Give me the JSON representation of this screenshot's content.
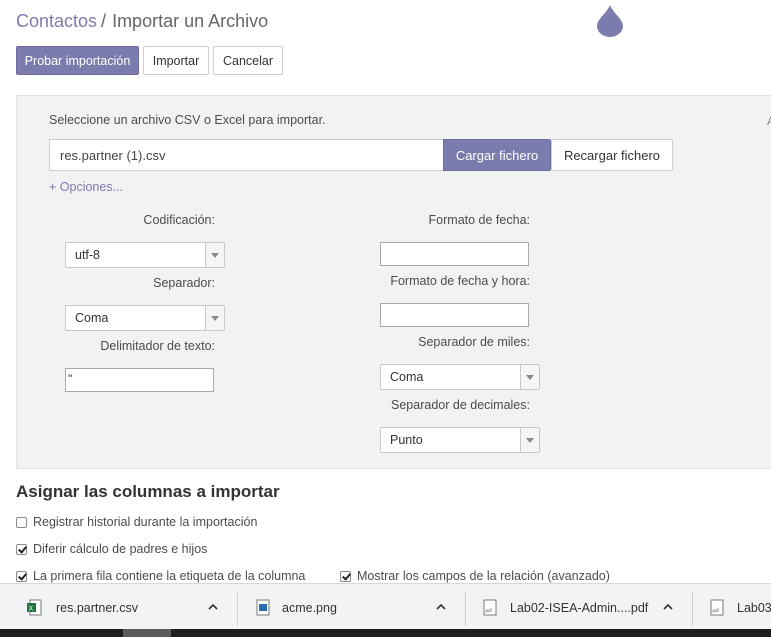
{
  "breadcrumb": {
    "parent": "Contactos",
    "separator": "/",
    "current": "Importar un Archivo"
  },
  "toolbar": {
    "test_label": "Probar importación",
    "import_label": "Importar",
    "cancel_label": "Cancelar"
  },
  "upload": {
    "prompt": "Seleccione un archivo CSV o Excel para importar.",
    "file_name": "res.partner (1).csv",
    "load_label": "Cargar fichero",
    "reload_label": "Recargar fichero",
    "options_link": "+ Opciones..."
  },
  "options": {
    "encoding_label": "Codificación:",
    "encoding_value": "utf-8",
    "separator_label": "Separador:",
    "separator_value": "Coma",
    "text_delimiter_label": "Delimitador de texto:",
    "text_delimiter_value": "\"",
    "date_format_label": "Formato de fecha:",
    "date_format_value": "",
    "datetime_format_label": "Formato de fecha y hora:",
    "datetime_format_value": "",
    "thousands_sep_label": "Separador de miles:",
    "thousands_sep_value": "Coma",
    "decimal_sep_label": "Separador de decimales:",
    "decimal_sep_value": "Punto"
  },
  "mapping": {
    "title": "Asignar las columnas a importar",
    "checkboxes": [
      {
        "label": "Registrar historial durante la importación",
        "checked": false
      },
      {
        "label": "Diferir cálculo de padres e hijos",
        "checked": true
      },
      {
        "label": "La primera fila contiene la etiqueta de la columna",
        "checked": true
      },
      {
        "label": "Mostrar los campos de la relación (avanzado)",
        "checked": true
      }
    ]
  },
  "downloads": [
    {
      "name": "res.partner.csv",
      "icon": "excel-file-icon"
    },
    {
      "name": "acme.png",
      "icon": "image-file-icon"
    },
    {
      "name": "Lab02-ISEA-Admin....pdf",
      "icon": "pdf-file-icon"
    },
    {
      "name": "Lab03",
      "icon": "pdf-file-icon"
    }
  ],
  "colors": {
    "accent": "#7c7bad",
    "panel_bg": "#f2f2f2",
    "link": "#7c7bad"
  }
}
